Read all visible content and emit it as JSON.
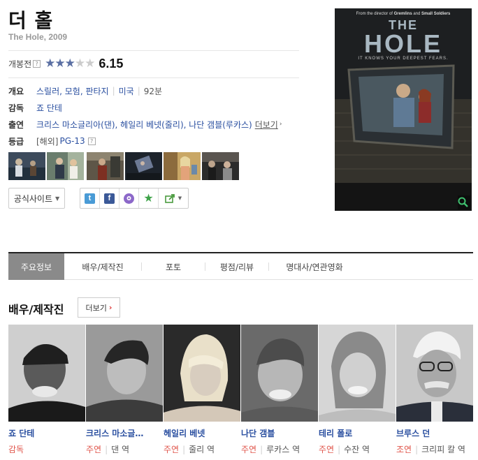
{
  "movie": {
    "title": "더 홀",
    "subtitle": "The Hole, 2009",
    "rating_label": "개봉전",
    "rating_help": "?",
    "stars_filled": 3,
    "stars_total": 5,
    "score": "6.15"
  },
  "info": {
    "summary_key": "개요",
    "genres": "스릴러, 모험, 판타지",
    "country": "미국",
    "runtime": "92분",
    "director_key": "감독",
    "director": "죠 단테",
    "cast_key": "출연",
    "cast_list": "크리스 마소글리아(댄), 헤일리 베넷(줄리), 나단 갬블(루카스)",
    "cast_more": "더보기",
    "grade_key": "등급",
    "grade_region": "[해외]",
    "grade": "PG-13",
    "grade_help": "?"
  },
  "buttons": {
    "official_site": "공식사이트",
    "twitter": "t",
    "facebook": "f",
    "more": "더보기"
  },
  "poster": {
    "tagline_top_prefix": "From the director of",
    "director_credit_1": "Gremlins",
    "director_credit_and": "and",
    "director_credit_2": "Small Soldiers",
    "poster_title_line1": "THE",
    "poster_title_line2": "HOLE",
    "tagline": "IT KNOWS YOUR DEEPEST FEARS."
  },
  "tabs": [
    {
      "label": "주요정보"
    },
    {
      "label": "배우/제작진"
    },
    {
      "label": "포토"
    },
    {
      "label": "평점/리뷰"
    },
    {
      "label": "명대사/연관영화"
    }
  ],
  "section": {
    "title": "배우/제작진"
  },
  "cast": [
    {
      "name": "죠 단테",
      "role": "감독",
      "character": ""
    },
    {
      "name": "크리스 마소글…",
      "role": "주연",
      "character": "댄 역"
    },
    {
      "name": "헤일리 베넷",
      "role": "주연",
      "character": "줄리 역"
    },
    {
      "name": "나단 갬블",
      "role": "주연",
      "character": "루카스 역"
    },
    {
      "name": "테리 폴로",
      "role": "주연",
      "character": "수잔 역"
    },
    {
      "name": "브루스 던",
      "role": "조연",
      "character": "크리피 칼 역"
    }
  ],
  "colors": {
    "link": "#2a4fa0",
    "role": "#e0564c",
    "star_on": "#5a6fa3",
    "active_tab": "#8a8a8a"
  }
}
